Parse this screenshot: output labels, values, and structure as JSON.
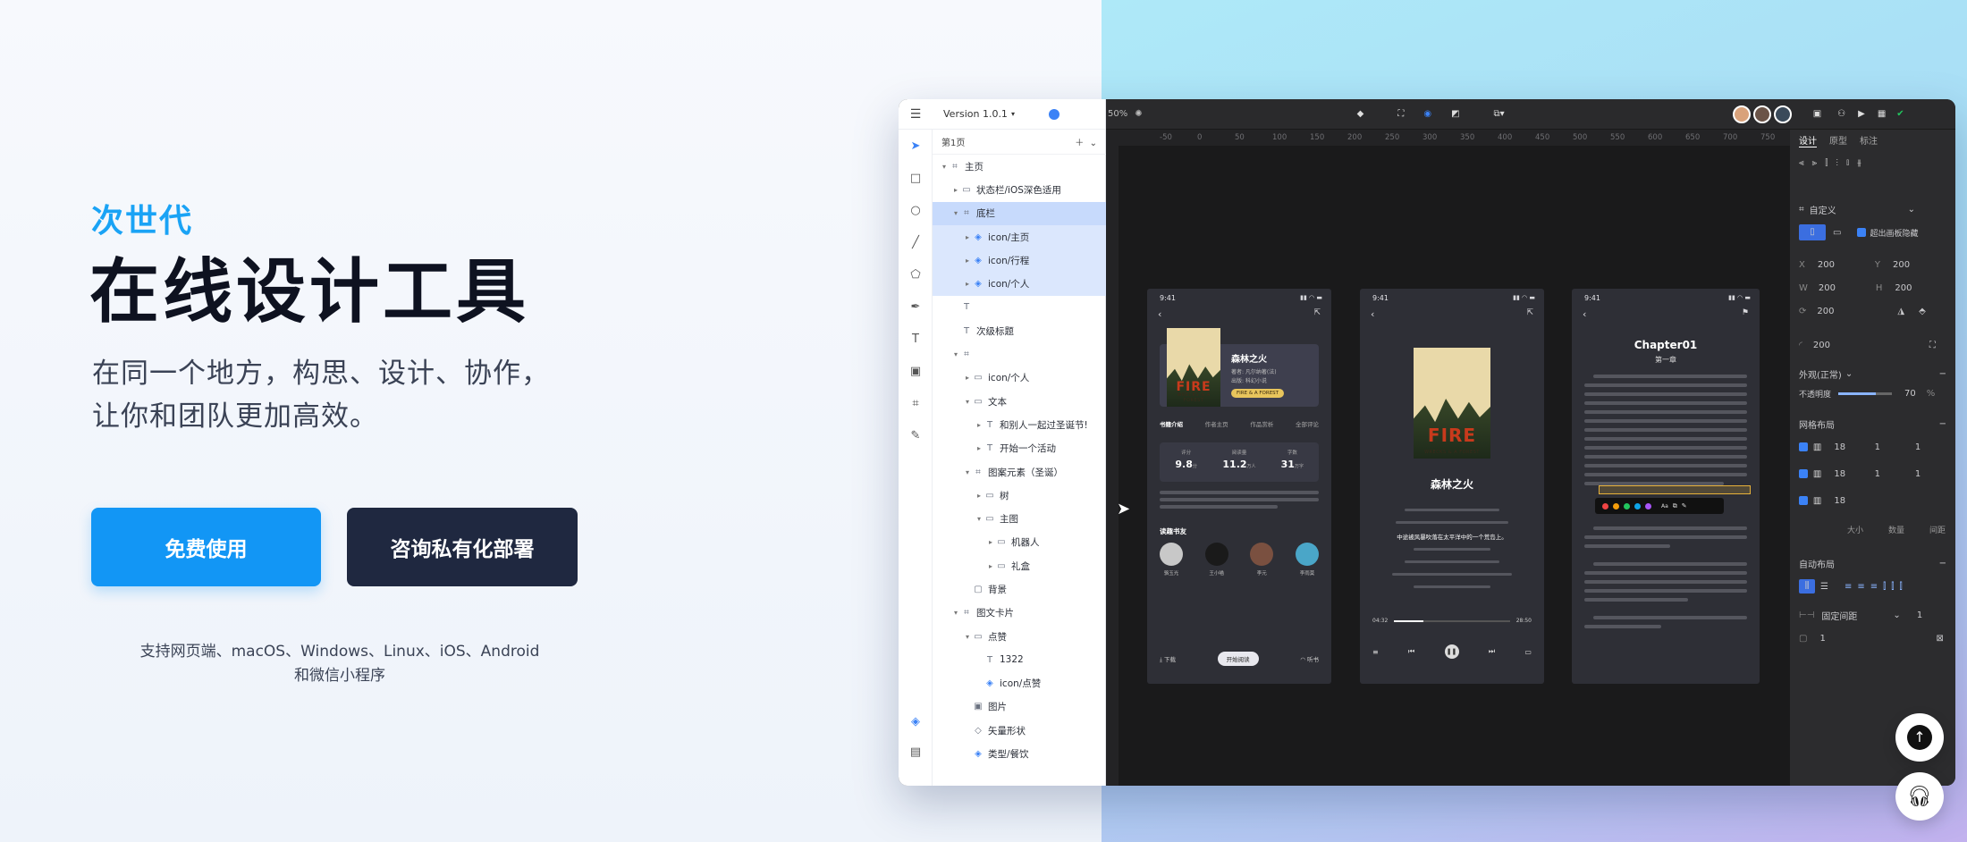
{
  "hero": {
    "eyebrow": "次世代",
    "title": "在线设计工具",
    "subtitle_line1": "在同一个地方，构思、设计、协作，",
    "subtitle_line2": "让你和团队更加高效。",
    "btn_free": "免费使用",
    "btn_consult": "咨询私有化部署",
    "platforms_line1": "支持网页端、macOS、Windows、Linux、iOS、Android",
    "platforms_line2": "和微信小程序"
  },
  "app": {
    "version": "Version 1.0.1",
    "page_name": "第1页",
    "zoom": "50%",
    "layers": [
      {
        "label": "主页",
        "indent": 0,
        "icon": "frame",
        "caret": "▾",
        "state": ""
      },
      {
        "label": "状态栏/iOS深色适用",
        "indent": 1,
        "icon": "folder",
        "caret": "▸",
        "state": ""
      },
      {
        "label": "底栏",
        "indent": 1,
        "icon": "frame",
        "caret": "▾",
        "state": "sel-strong"
      },
      {
        "label": "icon/主页",
        "indent": 2,
        "icon": "component",
        "caret": "▸",
        "state": "sel"
      },
      {
        "label": "icon/行程",
        "indent": 2,
        "icon": "component",
        "caret": "▸",
        "state": "sel"
      },
      {
        "label": "icon/个人",
        "indent": 2,
        "icon": "component",
        "caret": "▸",
        "state": "sel"
      },
      {
        "label": "",
        "indent": 1,
        "icon": "text",
        "caret": "",
        "state": ""
      },
      {
        "label": "次级标题",
        "indent": 1,
        "icon": "text",
        "caret": "",
        "state": ""
      },
      {
        "label": "",
        "indent": 1,
        "icon": "frame",
        "caret": "▾",
        "state": ""
      },
      {
        "label": "icon/个人",
        "indent": 2,
        "icon": "folder",
        "caret": "▸",
        "state": ""
      },
      {
        "label": "文本",
        "indent": 2,
        "icon": "folder",
        "caret": "▾",
        "state": ""
      },
      {
        "label": "和别人一起过圣诞节!",
        "indent": 3,
        "icon": "text",
        "caret": "▸",
        "state": ""
      },
      {
        "label": "开始一个活动",
        "indent": 3,
        "icon": "text",
        "caret": "▸",
        "state": ""
      },
      {
        "label": "图案元素（圣诞）",
        "indent": 2,
        "icon": "frame",
        "caret": "▾",
        "state": ""
      },
      {
        "label": "树",
        "indent": 3,
        "icon": "folder",
        "caret": "▸",
        "state": ""
      },
      {
        "label": "主图",
        "indent": 3,
        "icon": "folder",
        "caret": "▾",
        "state": ""
      },
      {
        "label": "机器人",
        "indent": 4,
        "icon": "folder",
        "caret": "▸",
        "state": ""
      },
      {
        "label": "礼盒",
        "indent": 4,
        "icon": "folder",
        "caret": "▸",
        "state": ""
      },
      {
        "label": "背景",
        "indent": 2,
        "icon": "rect",
        "caret": "",
        "state": ""
      },
      {
        "label": "图文卡片",
        "indent": 1,
        "icon": "frame",
        "caret": "▾",
        "state": ""
      },
      {
        "label": "点赞",
        "indent": 2,
        "icon": "folder",
        "caret": "▾",
        "state": ""
      },
      {
        "label": "1322",
        "indent": 3,
        "icon": "text",
        "caret": "",
        "state": ""
      },
      {
        "label": "icon/点赞",
        "indent": 3,
        "icon": "component",
        "caret": "",
        "state": ""
      },
      {
        "label": "图片",
        "indent": 2,
        "icon": "image",
        "caret": "",
        "state": ""
      },
      {
        "label": "矢量形状",
        "indent": 2,
        "icon": "vector",
        "caret": "",
        "state": ""
      },
      {
        "label": "类型/餐饮",
        "indent": 2,
        "icon": "component",
        "caret": "",
        "state": ""
      }
    ],
    "ruler_ticks": [
      "-50",
      "0",
      "50",
      "100",
      "150",
      "200",
      "250",
      "300",
      "350",
      "400",
      "450",
      "500",
      "550",
      "600",
      "650",
      "700",
      "750"
    ],
    "right_panel": {
      "tabs": [
        "设计",
        "原型",
        "标注"
      ],
      "frame_preset": "自定义",
      "clip_label": "超出画板隐藏",
      "x": "200",
      "y": "200",
      "w": "200",
      "h": "200",
      "rotation": "200",
      "radius": "200",
      "appearance": "外观(正常)",
      "opacity_label": "不透明度",
      "opacity_value": "70",
      "opacity_unit": "%",
      "grid_title": "网格布局",
      "grid_rows": [
        {
          "v1": "18",
          "v2": "1",
          "v3": "1"
        },
        {
          "v1": "18",
          "v2": "1",
          "v3": "1"
        },
        {
          "v1": "18",
          "v2": "",
          "v3": ""
        }
      ],
      "grid_cols": [
        "大小",
        "数量",
        "间距"
      ],
      "auto_layout_title": "自动布局",
      "spacing_mode": "固定间距",
      "spacing_value": "1",
      "padding_value": "1"
    }
  },
  "phones": {
    "p1": {
      "time": "9:41",
      "book_title": "森林之火",
      "book_meta1": "著者: 凡尔纳著(法)",
      "book_meta2": "出版: 科幻小说",
      "tag": "FIRE & A FOREST",
      "tabs": [
        "书籍介绍",
        "作者主页",
        "作品赏析",
        "全部评论"
      ],
      "stats": [
        {
          "label": "评分",
          "value": "9.8",
          "unit": "分"
        },
        {
          "label": "阅读量",
          "value": "11.2",
          "unit": "万人"
        },
        {
          "label": "字数",
          "value": "31",
          "unit": "万字"
        }
      ],
      "readers_title": "读趣书友",
      "readers": [
        "骆玉光",
        "王小喵",
        "李元",
        "李雨莫"
      ],
      "bottom": [
        "下载",
        "开始阅读",
        "听书"
      ]
    },
    "p2": {
      "time": "9:41",
      "title": "森林之火",
      "highlight": "中途被风暴吹落在太平洋中的一个荒岛上。",
      "time_start": "04:32",
      "time_end": "28:50"
    },
    "p3": {
      "time": "9:41",
      "chapter": "Chapter01",
      "chapter_cn": "第一章"
    },
    "cover_fire": "FIRE",
    "cover_sub": "WRECKS & A FOREST"
  },
  "colors": {
    "accent": "#1296f5",
    "dark_button": "#1f2840",
    "eyebrow": "#1aa3f5"
  }
}
